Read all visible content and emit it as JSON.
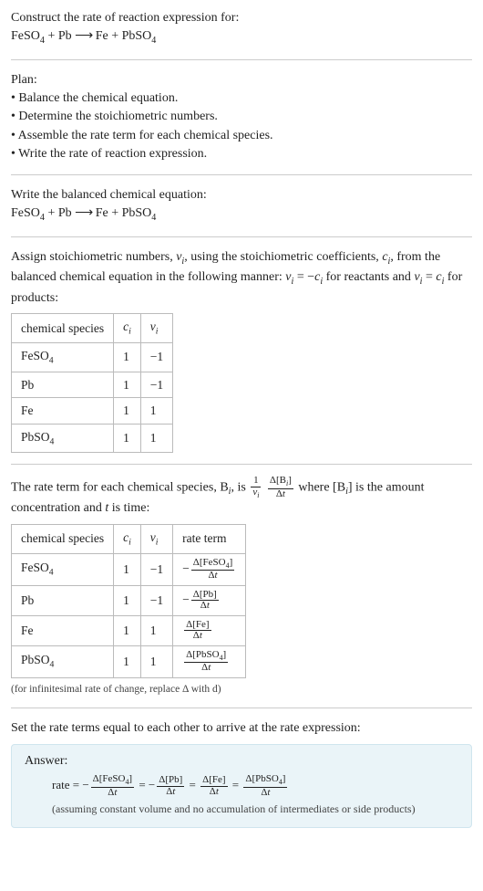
{
  "title": "Construct the rate of reaction expression for:",
  "reaction_html": "FeSO<span class='sub'>4</span> + Pb  <span class='arrow'>⟶</span>  Fe + PbSO<span class='sub'>4</span>",
  "plan_heading": "Plan:",
  "plan_items": [
    "Balance the chemical equation.",
    "Determine the stoichiometric numbers.",
    "Assemble the rate term for each chemical species.",
    "Write the rate of reaction expression."
  ],
  "balanced_heading": "Write the balanced chemical equation:",
  "stoich_text": {
    "line1_html": "Assign stoichiometric numbers, <i>ν<span class='sub'>i</span></i>, using the stoichiometric coefficients, <i>c<span class='sub'>i</span></i>, from the balanced chemical equation in the following manner: <i>ν<span class='sub'>i</span></i> = −<i>c<span class='sub'>i</span></i> for reactants and <i>ν<span class='sub'>i</span></i> = <i>c<span class='sub'>i</span></i> for products:"
  },
  "table1": {
    "headers_html": [
      "chemical species",
      "<i>c<span class='sub'>i</span></i>",
      "<i>ν<span class='sub'>i</span></i>"
    ],
    "rows_html": [
      [
        "FeSO<span class='sub'>4</span>",
        "1",
        "−1"
      ],
      [
        "Pb",
        "1",
        "−1"
      ],
      [
        "Fe",
        "1",
        "1"
      ],
      [
        "PbSO<span class='sub'>4</span>",
        "1",
        "1"
      ]
    ]
  },
  "rateterm_intro_html": "The rate term for each chemical species, B<span class='sub'><i>i</i></span>, is <span class='frac'><span class='num'>1</span><span class='den'><i>ν<span class=\"sub\">i</span></i></span></span> <span class='frac'><span class='num'>Δ[B<span class=\"sub\"><i>i</i></span>]</span><span class='den'>Δ<i>t</i></span></span> where [B<span class='sub'><i>i</i></span>] is the amount concentration and <i>t</i> is time:",
  "table2": {
    "headers_html": [
      "chemical species",
      "<i>c<span class='sub'>i</span></i>",
      "<i>ν<span class='sub'>i</span></i>",
      "rate term"
    ],
    "rows_html": [
      [
        "FeSO<span class='sub'>4</span>",
        "1",
        "−1",
        "−<span class='frac'><span class='num'>Δ[FeSO<span class=\"sub\">4</span>]</span><span class='den'>Δ<i>t</i></span></span>"
      ],
      [
        "Pb",
        "1",
        "−1",
        "−<span class='frac'><span class='num'>Δ[Pb]</span><span class='den'>Δ<i>t</i></span></span>"
      ],
      [
        "Fe",
        "1",
        "1",
        "<span class='frac'><span class='num'>Δ[Fe]</span><span class='den'>Δ<i>t</i></span></span>"
      ],
      [
        "PbSO<span class='sub'>4</span>",
        "1",
        "1",
        "<span class='frac'><span class='num'>Δ[PbSO<span class=\"sub\">4</span>]</span><span class='den'>Δ<i>t</i></span></span>"
      ]
    ]
  },
  "infinitesimal_note": "(for infinitesimal rate of change, replace Δ with d)",
  "set_equal_text": "Set the rate terms equal to each other to arrive at the rate expression:",
  "answer": {
    "label": "Answer:",
    "rate_html": "rate = −<span class='frac'><span class='num'>Δ[FeSO<span class=\"sub\">4</span>]</span><span class='den'>Δ<i>t</i></span></span> = −<span class='frac'><span class='num'>Δ[Pb]</span><span class='den'>Δ<i>t</i></span></span> = <span class='frac'><span class='num'>Δ[Fe]</span><span class='den'>Δ<i>t</i></span></span> = <span class='frac'><span class='num'>Δ[PbSO<span class=\"sub\">4</span>]</span><span class='den'>Δ<i>t</i></span></span>",
    "assumption": "(assuming constant volume and no accumulation of intermediates or side products)"
  }
}
